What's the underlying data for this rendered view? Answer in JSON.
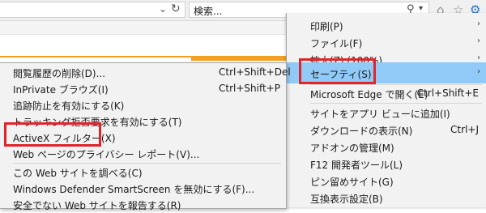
{
  "toolbar": {
    "search_placeholder": "検索...",
    "chevron_glyph": "⌄",
    "reload_glyph": "↻",
    "magnifier_glyph": "⚲",
    "dropdown_glyph": "▾",
    "home_glyph": "⌂",
    "star_glyph": "☆",
    "gear_glyph": "⚙"
  },
  "main_menu": {
    "items": [
      {
        "label": "印刷(P)",
        "arrow": "›"
      },
      {
        "label": "ファイル(F)",
        "arrow": "›"
      },
      {
        "label": "拡大(Z) (100%)",
        "arrow": "›"
      },
      {
        "label": "セーフティ(S)",
        "arrow": "›"
      },
      {
        "label": "Microsoft Edge で開く(E)",
        "shortcut": "Ctrl+Shift+E"
      },
      {
        "label": "サイトをアプリ ビューに追加(I)"
      },
      {
        "label": "ダウンロードの表示(N)",
        "shortcut": "Ctrl+J"
      },
      {
        "label": "アドオンの管理(M)"
      },
      {
        "label": "F12 開発者ツール(L)"
      },
      {
        "label": "ピン留めサイト(G)"
      },
      {
        "label": "互換表示設定(B)"
      }
    ]
  },
  "safety_menu": {
    "items": [
      {
        "label": "閲覧履歴の削除(D)...",
        "shortcut": "Ctrl+Shift+Del"
      },
      {
        "label": "InPrivate ブラウズ(I)",
        "shortcut": "Ctrl+Shift+P"
      },
      {
        "label": "追跡防止を有効にする(K)"
      },
      {
        "label": "トラッキング拒否要求を有効にする(T)"
      },
      {
        "label": "ActiveX フィルター(X)"
      },
      {
        "label": "Web ページのプライバシー レポート(V)..."
      },
      {
        "label": "この Web サイトを調べる(C)"
      },
      {
        "label": "Windows Defender SmartScreen を無効にする(F)..."
      },
      {
        "label": "安全でない Web サイトを報告する(R)"
      }
    ]
  },
  "colors": {
    "menu_bg": "#f2f2f2",
    "highlight": "#91c9f7",
    "annotation_red": "#e0242a",
    "accent_orange": "#f3a020"
  }
}
